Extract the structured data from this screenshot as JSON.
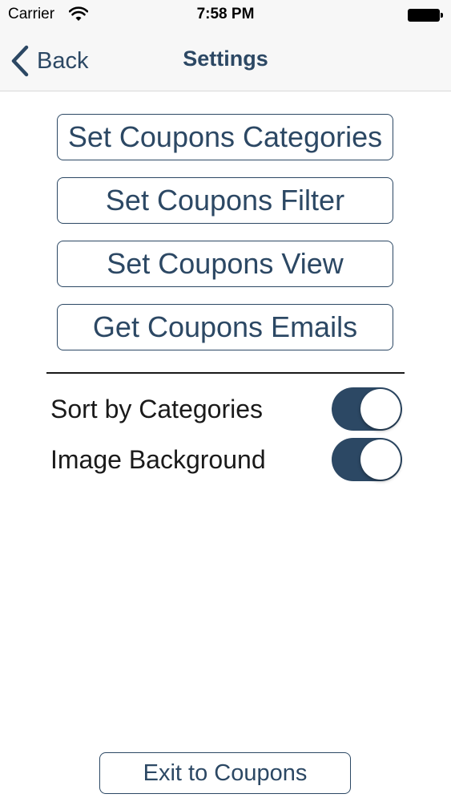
{
  "status_bar": {
    "carrier": "Carrier",
    "time": "7:58 PM",
    "icons": [
      "wifi-icon",
      "battery-icon"
    ]
  },
  "nav": {
    "back_label": "Back",
    "back_icon": "chevron-left-icon",
    "title": "Settings"
  },
  "buttons": [
    {
      "label": "Set Coupons Categories"
    },
    {
      "label": "Set Coupons Filter"
    },
    {
      "label": "Set Coupons View"
    },
    {
      "label": "Get Coupons Emails"
    }
  ],
  "toggles": [
    {
      "label": "Sort by Categories",
      "on": true
    },
    {
      "label": "Image Background",
      "on": true
    }
  ],
  "footer": {
    "exit_label": "Exit to Coupons"
  },
  "colors": {
    "accent": "#2c4864",
    "bar_background": "#f7f7f7",
    "background": "#ffffff"
  }
}
